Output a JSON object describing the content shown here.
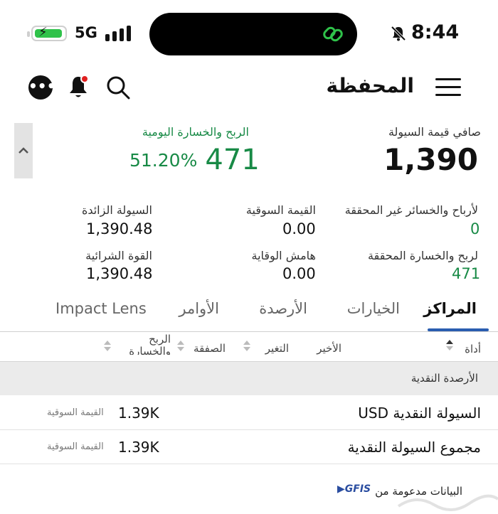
{
  "status_bar": {
    "network": "5G",
    "time": "8:44"
  },
  "header": {
    "title": "المحفظة"
  },
  "summary": {
    "net_liquidation_label": "صافي قيمة السيولة",
    "net_liquidation_value": "1,390",
    "daily_pnl_label": "الربح والخسارة اليومية",
    "daily_pnl_value": "471",
    "daily_pnl_percent": "51.20%",
    "unrealized_pnl_label": "لأرباح والخسائر غير المحققة",
    "unrealized_pnl_value": "0",
    "market_value_label": "القيمة السوقية",
    "market_value_value": "0.00",
    "excess_liquidity_label": "السيولة الزائدة",
    "excess_liquidity_value": "1,390.48",
    "realized_pnl_label": "لربح والخسارة المحققة",
    "realized_pnl_value": "471",
    "maintenance_margin_label": "هامش الوقاية",
    "maintenance_margin_value": "0.00",
    "buying_power_label": "القوة الشرائية",
    "buying_power_value": "1,390.48"
  },
  "tabs": [
    {
      "label": "المراكز",
      "active": true
    },
    {
      "label": "الخيارات",
      "active": false
    },
    {
      "label": "الأرصدة",
      "active": false
    },
    {
      "label": "الأوامر",
      "active": false
    },
    {
      "label": "Impact Lens",
      "active": false
    }
  ],
  "columns": {
    "instrument": "أداة",
    "last": "الأخير",
    "change": "التغير",
    "trade": "الصفقة",
    "pnl_line1": "الربح",
    "pnl_line2": "والخسارة"
  },
  "section": {
    "title": "الأرصدة النقدية",
    "rows": [
      {
        "name": "السيولة النقدية USD",
        "value": "1.39K",
        "sub_label": "القيمة السوقية"
      },
      {
        "name": "مجموع السيولة النقدية",
        "value": "1.39K",
        "sub_label": "القيمة السوقية"
      }
    ]
  },
  "footer": {
    "text": "البيانات مدعومة من",
    "brand": "GFIS"
  },
  "colors": {
    "positive": "#188a46",
    "accent": "#2a5db0",
    "battery": "#2fc24a"
  }
}
